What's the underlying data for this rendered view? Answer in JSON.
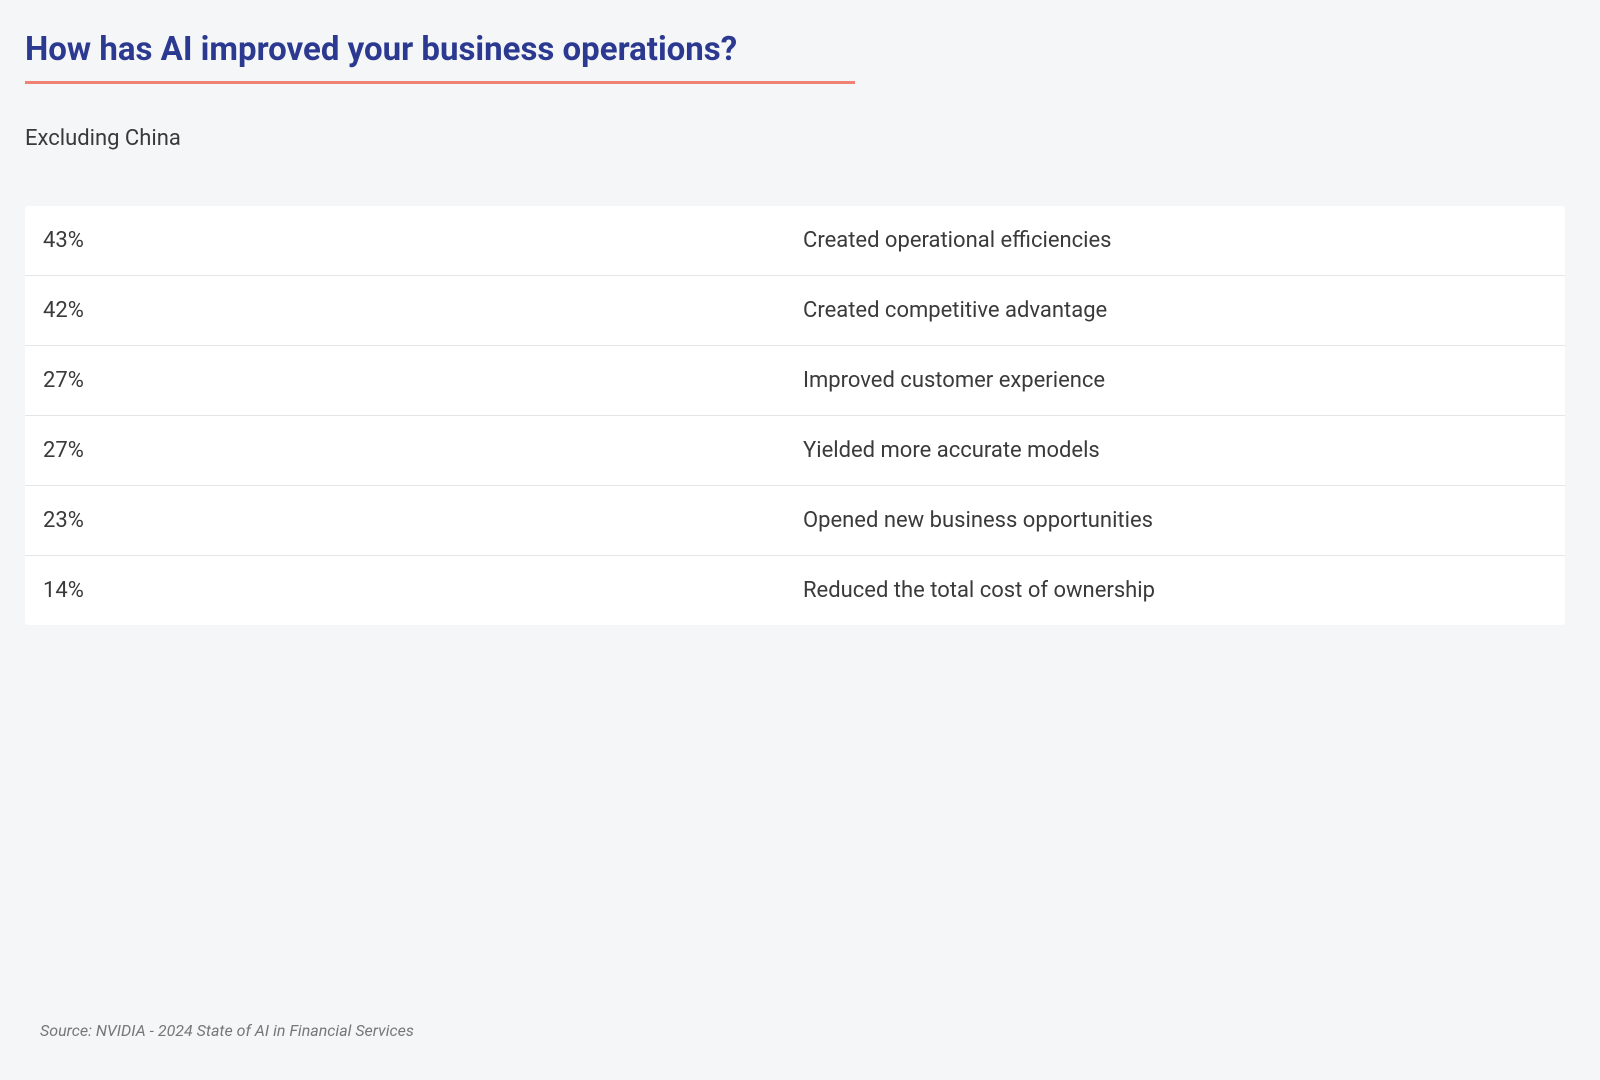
{
  "title": "How has AI improved your business operations?",
  "subtitle": "Excluding China",
  "source": "Source: NVIDIA - 2024 State of AI in Financial Services",
  "chart_data": {
    "type": "table",
    "title": "How has AI improved your business operations?",
    "subtitle": "Excluding China",
    "rows": [
      {
        "pct": "43%",
        "label": "Created operational efficiencies"
      },
      {
        "pct": "42%",
        "label": "Created competitive advantage"
      },
      {
        "pct": "27%",
        "label": "Improved customer experience"
      },
      {
        "pct": "27%",
        "label": "Yielded more accurate models"
      },
      {
        "pct": "23%",
        "label": "Opened new business opportunities"
      },
      {
        "pct": "14%",
        "label": "Reduced the total cost of ownership"
      }
    ]
  }
}
